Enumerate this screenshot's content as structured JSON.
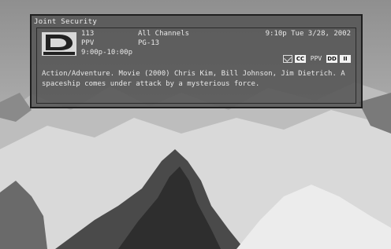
{
  "banner": {
    "title": "Joint Security",
    "channel_number": "113",
    "channel_name": "PPV",
    "time_range": "9:00p-10:00p",
    "channel_list": "All Channels",
    "rating": "PG-13",
    "current_datetime": "9:10p Tue 3/28, 2002",
    "description": "Action/Adventure. Movie (2000) Chris Kim, Bill Johnson, Jim Dietrich. A spaceship comes under attack by a mysterious force.",
    "logo_text": "DIRECTV",
    "badges": {
      "mail": "mail-icon",
      "cc_label": "CC",
      "ppv_label": "PPV",
      "dd_label": "DD",
      "dual_label": "II"
    }
  },
  "colors": {
    "panel": "#555555",
    "panel_border": "#1e1e1e",
    "text": "#e8e8e8"
  }
}
